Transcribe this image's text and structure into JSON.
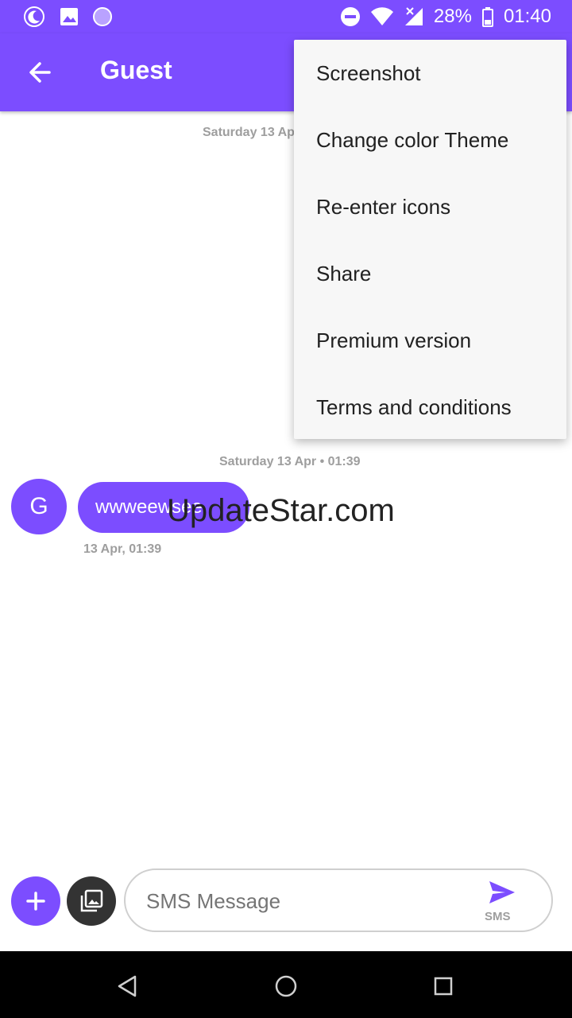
{
  "status_bar": {
    "battery": "28%",
    "time": "01:40",
    "icons": [
      "moon-icon",
      "image-icon",
      "circle-icon",
      "dnd-icon",
      "wifi-icon",
      "signal-icon",
      "battery-icon"
    ]
  },
  "app_bar": {
    "title": "Guest",
    "back_icon": "arrow-left-icon"
  },
  "overflow_menu": {
    "items": [
      {
        "label": "Screenshot"
      },
      {
        "label": "Change color Theme"
      },
      {
        "label": "Re-enter icons"
      },
      {
        "label": "Share"
      },
      {
        "label": "Premium version"
      },
      {
        "label": "Terms and conditions"
      }
    ]
  },
  "conversation": {
    "date_separator_top": "Saturday 13 Ap",
    "date_separator": "Saturday 13 Apr • 01:39",
    "messages": [
      {
        "avatar_letter": "G",
        "text": "wwweewsee",
        "time": "13 Apr, 01:39"
      }
    ],
    "watermark": "UpdateStar.com"
  },
  "composer": {
    "placeholder": "SMS Message",
    "send_label": "SMS",
    "add_icon": "plus-icon",
    "gallery_icon": "gallery-icon",
    "send_icon": "send-icon"
  },
  "nav_bar": {
    "icons": [
      "back-triangle-icon",
      "home-circle-icon",
      "recents-square-icon"
    ]
  },
  "colors": {
    "accent": "#7c4dff",
    "menu_bg": "#f7f7f7",
    "meta_text": "#9e9e9e"
  }
}
